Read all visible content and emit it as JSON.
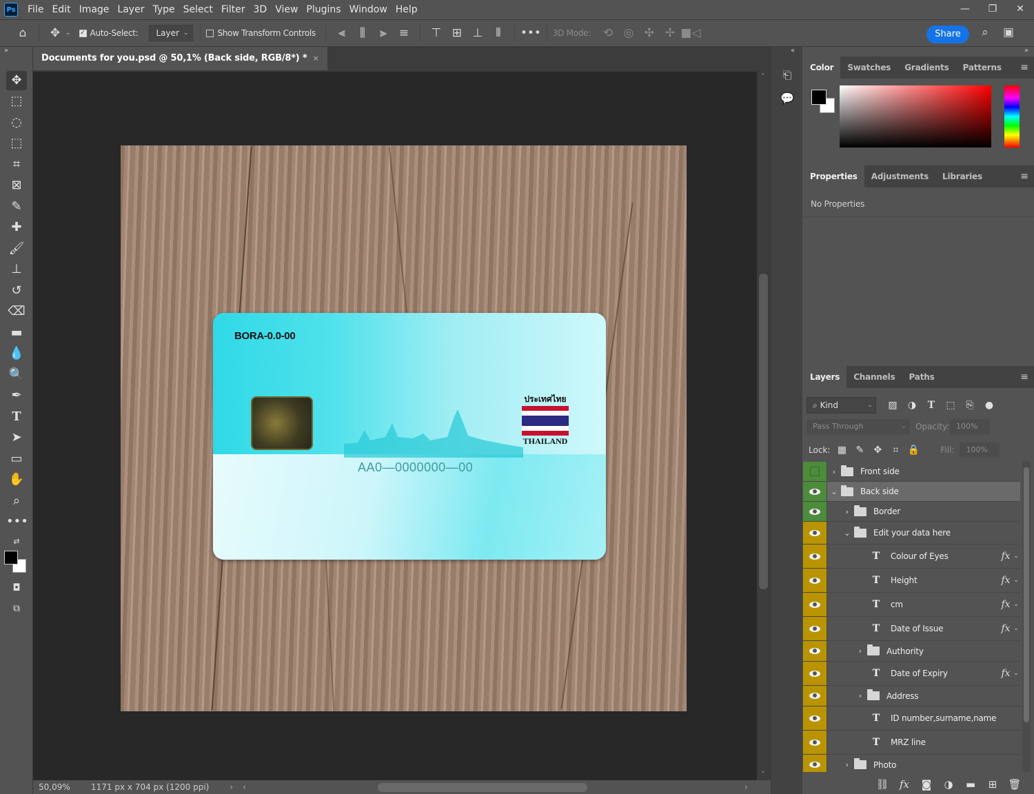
{
  "menubar": {
    "logo": "Ps",
    "items": [
      "File",
      "Edit",
      "Image",
      "Layer",
      "Type",
      "Select",
      "Filter",
      "3D",
      "View",
      "Plugins",
      "Window",
      "Help"
    ]
  },
  "options": {
    "auto_select_label": "Auto-Select:",
    "auto_select_checked": true,
    "target_value": "Layer",
    "transform_label": "Show Transform Controls",
    "mode_label": "3D Mode:",
    "share_label": "Share"
  },
  "document": {
    "tab_title": "Documents for you.psd @ 50,1% (Back side, RGB/8*) *",
    "close_glyph": "×",
    "zoom": "50,09%",
    "dimensions": "1171 px x 704 px (1200 ppi)"
  },
  "card": {
    "code": "BORA-0.0-00",
    "country_thai": "ประเทศไทย",
    "country": "THAILAND",
    "number": "AA0—0000000—00"
  },
  "color_panel": {
    "tabs": [
      "Color",
      "Swatches",
      "Gradients",
      "Patterns"
    ],
    "foreground": "#000000",
    "background": "#ffffff"
  },
  "properties_panel": {
    "tabs": [
      "Properties",
      "Adjustments",
      "Libraries"
    ],
    "empty_text": "No Properties"
  },
  "layers_panel": {
    "tabs": [
      "Layers",
      "Channels",
      "Paths"
    ],
    "kind_label": "Kind",
    "blend_mode": "Pass Through",
    "opacity_label": "Opacity:",
    "opacity_value": "100%",
    "lock_label": "Lock:",
    "fill_label": "Fill:",
    "fill_value": "100%",
    "layers": [
      {
        "name": "Front side",
        "type": "group",
        "visible": false,
        "color": "#4c8c3b",
        "expanded": false
      },
      {
        "name": "Back side",
        "type": "group",
        "visible": true,
        "color": "#4c8c3b",
        "expanded": true,
        "selected": true
      },
      {
        "name": "Border",
        "type": "group",
        "visible": true,
        "color": "#4c8c3b",
        "expanded": false
      },
      {
        "name": "Edit your data here",
        "type": "group",
        "visible": true,
        "color": "#b99400",
        "expanded": true
      },
      {
        "name": "Colour of Eyes",
        "type": "text",
        "visible": true,
        "color": "#b99400",
        "fx": true
      },
      {
        "name": "Height",
        "type": "text",
        "visible": true,
        "color": "#b99400",
        "fx": true
      },
      {
        "name": "cm",
        "type": "text",
        "visible": true,
        "color": "#b99400",
        "fx": true
      },
      {
        "name": "Date of Issue",
        "type": "text",
        "visible": true,
        "color": "#b99400",
        "fx": true
      },
      {
        "name": "Authority",
        "type": "group",
        "visible": true,
        "color": "#b99400",
        "expanded": false
      },
      {
        "name": "Date of Expiry",
        "type": "text",
        "visible": true,
        "color": "#b99400",
        "fx": true
      },
      {
        "name": "Address",
        "type": "group",
        "visible": true,
        "color": "#b99400",
        "expanded": false
      },
      {
        "name": "ID number,surname,name",
        "type": "text",
        "visible": true,
        "color": "#b99400",
        "fx": false
      },
      {
        "name": "MRZ line",
        "type": "text",
        "visible": true,
        "color": "#b99400",
        "fx": false
      },
      {
        "name": "Photo",
        "type": "group",
        "visible": true,
        "color": "#b99400",
        "expanded": false
      }
    ]
  }
}
